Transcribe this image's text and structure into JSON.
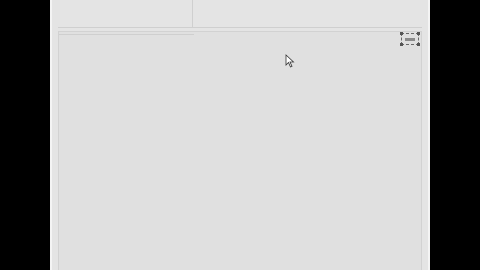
{
  "window": {
    "background": "#e4e4e4"
  },
  "icons": {
    "resize": "resize-handle-icon",
    "cursor": "mouse-pointer-icon"
  }
}
